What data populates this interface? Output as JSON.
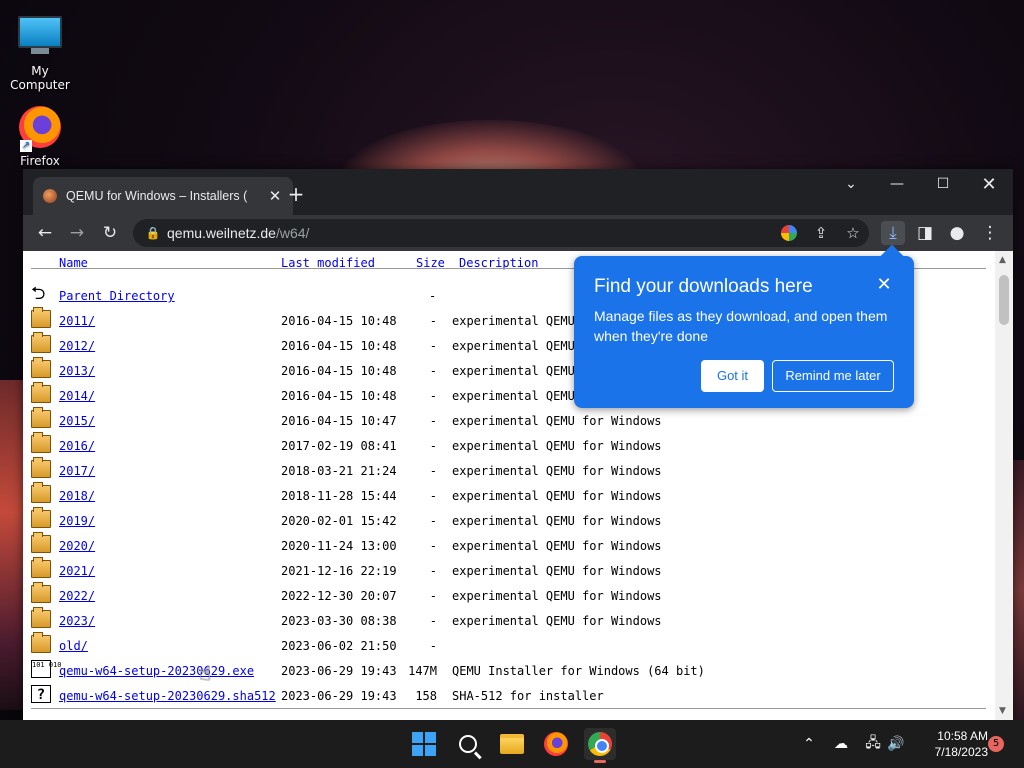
{
  "desktop": {
    "icons": [
      {
        "label": "My Computer"
      },
      {
        "label": "Firefox"
      }
    ]
  },
  "browser": {
    "tab_title": "QEMU for Windows – Installers (",
    "url_host": "qemu.weilnetz.de",
    "url_path": "/w64/"
  },
  "listing": {
    "headers": {
      "name": "Name",
      "modified": "Last modified",
      "size": "Size",
      "description": "Description"
    },
    "parent": {
      "name": "Parent Directory",
      "size": "-"
    },
    "rows": [
      {
        "icon": "folder",
        "name": "2011/",
        "modified": "2016-04-15 10:48",
        "size": "-",
        "description": "experimental QEMU"
      },
      {
        "icon": "folder",
        "name": "2012/",
        "modified": "2016-04-15 10:48",
        "size": "-",
        "description": "experimental QEMU"
      },
      {
        "icon": "folder",
        "name": "2013/",
        "modified": "2016-04-15 10:48",
        "size": "-",
        "description": "experimental QEMU"
      },
      {
        "icon": "folder",
        "name": "2014/",
        "modified": "2016-04-15 10:48",
        "size": "-",
        "description": "experimental QEMU"
      },
      {
        "icon": "folder",
        "name": "2015/",
        "modified": "2016-04-15 10:47",
        "size": "-",
        "description": "experimental QEMU for Windows"
      },
      {
        "icon": "folder",
        "name": "2016/",
        "modified": "2017-02-19 08:41",
        "size": "-",
        "description": "experimental QEMU for Windows"
      },
      {
        "icon": "folder",
        "name": "2017/",
        "modified": "2018-03-21 21:24",
        "size": "-",
        "description": "experimental QEMU for Windows"
      },
      {
        "icon": "folder",
        "name": "2018/",
        "modified": "2018-11-28 15:44",
        "size": "-",
        "description": "experimental QEMU for Windows"
      },
      {
        "icon": "folder",
        "name": "2019/",
        "modified": "2020-02-01 15:42",
        "size": "-",
        "description": "experimental QEMU for Windows"
      },
      {
        "icon": "folder",
        "name": "2020/",
        "modified": "2020-11-24 13:00",
        "size": "-",
        "description": "experimental QEMU for Windows"
      },
      {
        "icon": "folder",
        "name": "2021/",
        "modified": "2021-12-16 22:19",
        "size": "-",
        "description": "experimental QEMU for Windows"
      },
      {
        "icon": "folder",
        "name": "2022/",
        "modified": "2022-12-30 20:07",
        "size": "-",
        "description": "experimental QEMU for Windows"
      },
      {
        "icon": "folder",
        "name": "2023/",
        "modified": "2023-03-30 08:38",
        "size": "-",
        "description": "experimental QEMU for Windows"
      },
      {
        "icon": "folder",
        "name": "old/",
        "modified": "2023-06-02 21:50",
        "size": "-",
        "description": ""
      },
      {
        "icon": "binary",
        "name": "qemu-w64-setup-20230629.exe",
        "modified": "2023-06-29 19:43",
        "size": "147M",
        "description": "QEMU Installer for Windows (64 bit)"
      },
      {
        "icon": "unknown",
        "name": "qemu-w64-setup-20230629.sha512",
        "modified": "2023-06-29 19:43",
        "size": "158",
        "description": "SHA-512 for installer"
      }
    ]
  },
  "download_bubble": {
    "title": "Find your downloads here",
    "body": "Manage files as they download, and open them when they're done",
    "got_it": "Got it",
    "remind": "Remind me later"
  },
  "taskbar": {
    "time": "10:58 AM",
    "date": "7/18/2023",
    "notification_count": "5"
  },
  "colors": {
    "accent": "#1a73e8",
    "link": "#0000ee",
    "chrome_dark": "#35363a"
  }
}
